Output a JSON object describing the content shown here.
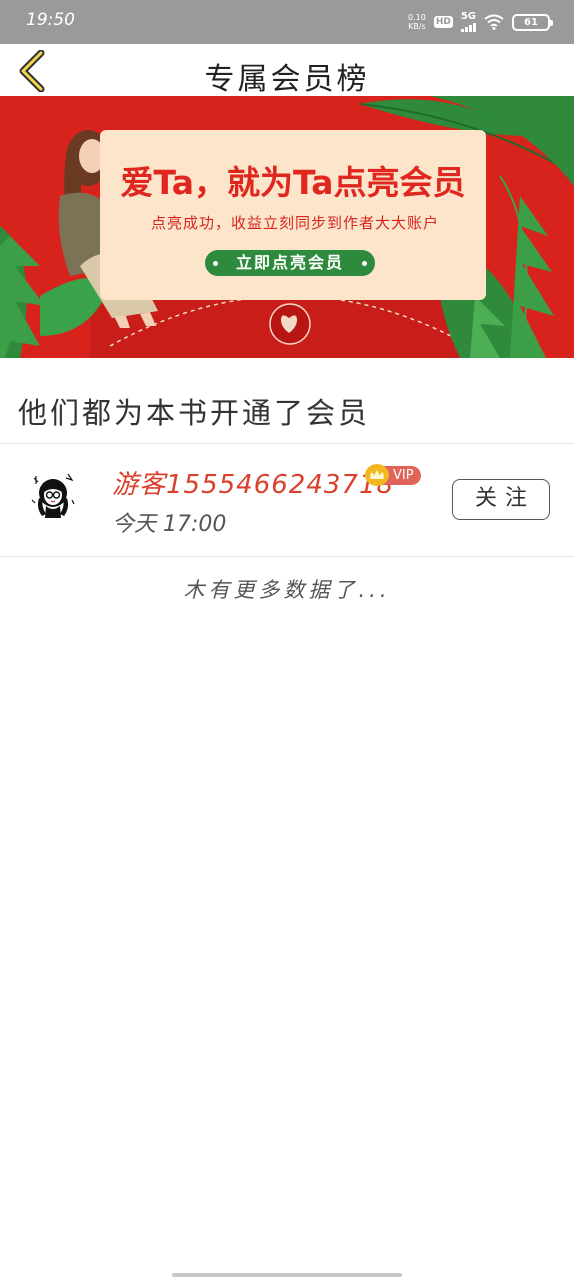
{
  "status_bar": {
    "time": "19:50",
    "net_speed_value": "0.10",
    "net_speed_unit": "KB/s",
    "hd_label": "HD",
    "network_type": "5G",
    "battery_level": "61"
  },
  "header": {
    "title": "专属会员榜",
    "back_icon": "chevron-left-icon"
  },
  "banner": {
    "headline": "爱Ta，就为Ta点亮会员",
    "subtitle": "点亮成功，收益立刻同步到作者大大账户",
    "cta_label": "立即点亮会员",
    "colors": {
      "background": "#d7231c",
      "card": "#fce5cb",
      "cta": "#2e8b3d",
      "leaf": "#2f8a3c"
    }
  },
  "section": {
    "title": "他们都为本书开通了会员"
  },
  "members": [
    {
      "name": "游客1555466243718",
      "badge": "VIP",
      "time": "今天 17:00",
      "follow_label": "关注"
    }
  ],
  "footer": {
    "no_more_text": "木有更多数据了..."
  },
  "colors": {
    "accent_name": "#d9412c",
    "vip_badge": "#e0645a",
    "crown": "#f3b821",
    "status_bar_bg": "#9a9a9a"
  }
}
